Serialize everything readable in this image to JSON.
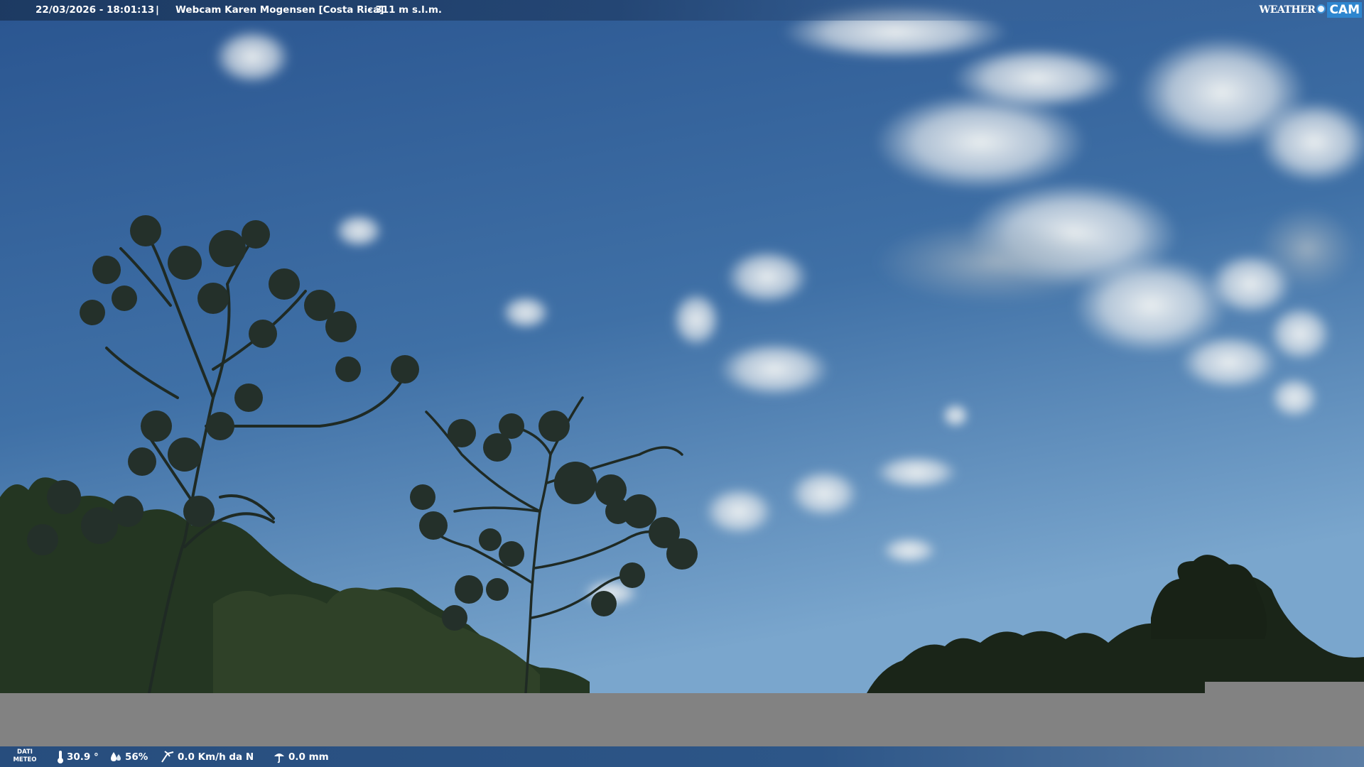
{
  "overlay": {
    "timestamp": "22/03/2026 - 18:01:13",
    "separator": "|",
    "camera_title": "Webcam Karen Mogensen [Costa Rica]",
    "altitude": "- 311 m s.l.m.",
    "logo_weather": "WEATHER",
    "logo_cam": "CAM"
  },
  "weather_bar": {
    "label_line1": "DATI",
    "label_line2": "METEO",
    "temperature": "30.9 °",
    "humidity": "56%",
    "wind": "0.0 Km/h da N",
    "rain": "0.0 mm"
  },
  "colors": {
    "sky_top": "#2c5790",
    "sky_bottom": "#6f9dc6",
    "bar_blue": "#274d7d",
    "logo_blue": "#2e86cf",
    "gray_band": "#828282",
    "foliage": "#1d2a1e"
  },
  "icons": [
    "thermometer-icon",
    "humidity-icon",
    "wind-icon",
    "rain-icon"
  ]
}
